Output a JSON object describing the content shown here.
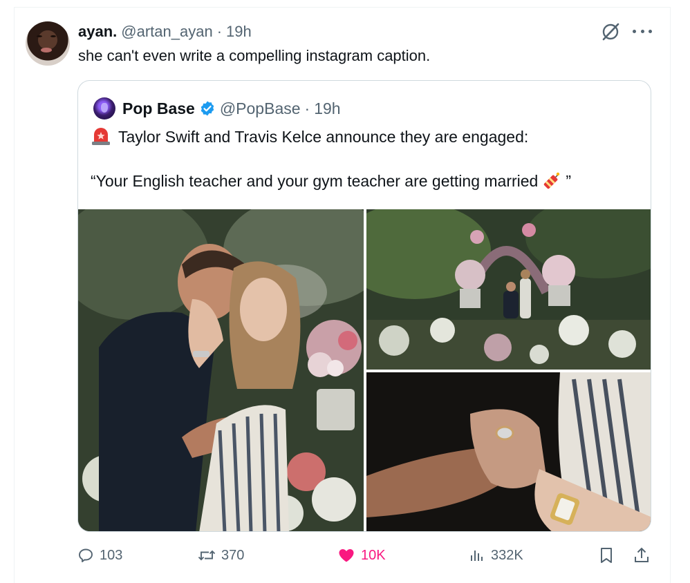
{
  "tweet": {
    "display_name": "ayan.",
    "handle": "@artan_ayan",
    "separator": "·",
    "time": "19h",
    "text": "she can't even write a compelling instagram caption."
  },
  "quote": {
    "display_name": "Pop Base",
    "handle": "@PopBase",
    "separator": "·",
    "time": "19h",
    "line1": "Taylor Swift and Travis Kelce announce they are engaged:",
    "line2_open": "“Your English teacher and your gym teacher are getting married",
    "line2_close": "”"
  },
  "actions": {
    "replies": "103",
    "reposts": "370",
    "likes": "10K",
    "views": "332K"
  },
  "colors": {
    "like_accent": "#f91880",
    "muted_text": "#536471",
    "verified_blue": "#1d9bf0",
    "border": "#cfd9de"
  },
  "icons": [
    "grok-icon",
    "more-icon",
    "verified-badge-icon",
    "siren-emoji-icon",
    "firecracker-emoji-icon",
    "reply-icon",
    "retweet-icon",
    "like-icon",
    "views-icon",
    "bookmark-icon",
    "share-icon"
  ]
}
